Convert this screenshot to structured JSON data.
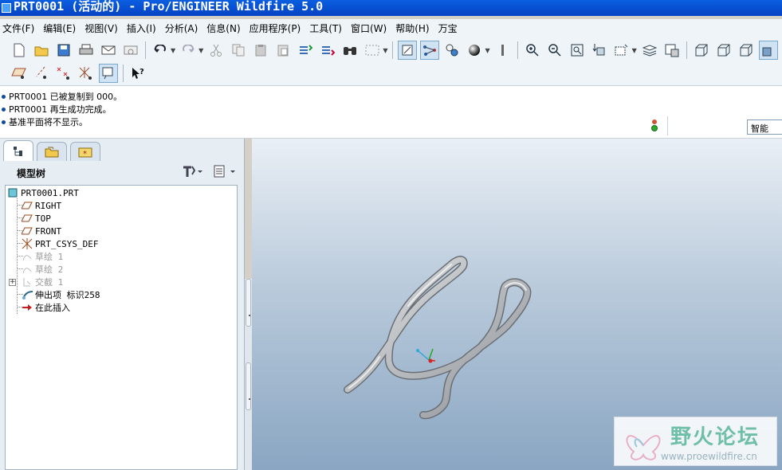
{
  "window": {
    "title": "PRT0001 (活动的) - Pro/ENGINEER Wildfire 5.0"
  },
  "menu": [
    {
      "label": "文件(F)"
    },
    {
      "label": "编辑(E)"
    },
    {
      "label": "视图(V)"
    },
    {
      "label": "插入(I)"
    },
    {
      "label": "分析(A)"
    },
    {
      "label": "信息(N)"
    },
    {
      "label": "应用程序(P)"
    },
    {
      "label": "工具(T)"
    },
    {
      "label": "窗口(W)"
    },
    {
      "label": "帮助(H)"
    },
    {
      "label": "万宝"
    }
  ],
  "messages": [
    {
      "text": "PRT0001 已被复制到 000。"
    },
    {
      "text": "PRT0001 再生成功完成。"
    },
    {
      "text": "基准平面将不显示。"
    }
  ],
  "filter": {
    "value": "智能"
  },
  "panel": {
    "title": "模型树"
  },
  "tree": [
    {
      "label": "PRT0001.PRT",
      "icon": "part-icon",
      "dim": false
    },
    {
      "label": "RIGHT",
      "icon": "datum-plane-icon",
      "dim": false
    },
    {
      "label": "TOP",
      "icon": "datum-plane-icon",
      "dim": false
    },
    {
      "label": "FRONT",
      "icon": "datum-plane-icon",
      "dim": false
    },
    {
      "label": "PRT_CSYS_DEF",
      "icon": "csys-icon",
      "dim": false
    },
    {
      "label": "草绘 1",
      "icon": "sketch-icon",
      "dim": true
    },
    {
      "label": "草绘 2",
      "icon": "sketch-icon",
      "dim": true
    },
    {
      "label": "交截 1",
      "icon": "intersect-icon",
      "dim": true
    },
    {
      "label": "伸出项 标识258",
      "icon": "sweep-icon",
      "dim": false
    },
    {
      "label": "在此插入",
      "icon": "insert-arrow-icon",
      "dim": false
    }
  ],
  "watermark": {
    "title": "野火论坛",
    "url": "www.proewildfire.cn"
  },
  "colors": {
    "title_bar": "#0a5fe0",
    "viewport_top": "#e9eff5",
    "viewport_bottom": "#8aa6c2",
    "model": "#b5b8bb"
  }
}
